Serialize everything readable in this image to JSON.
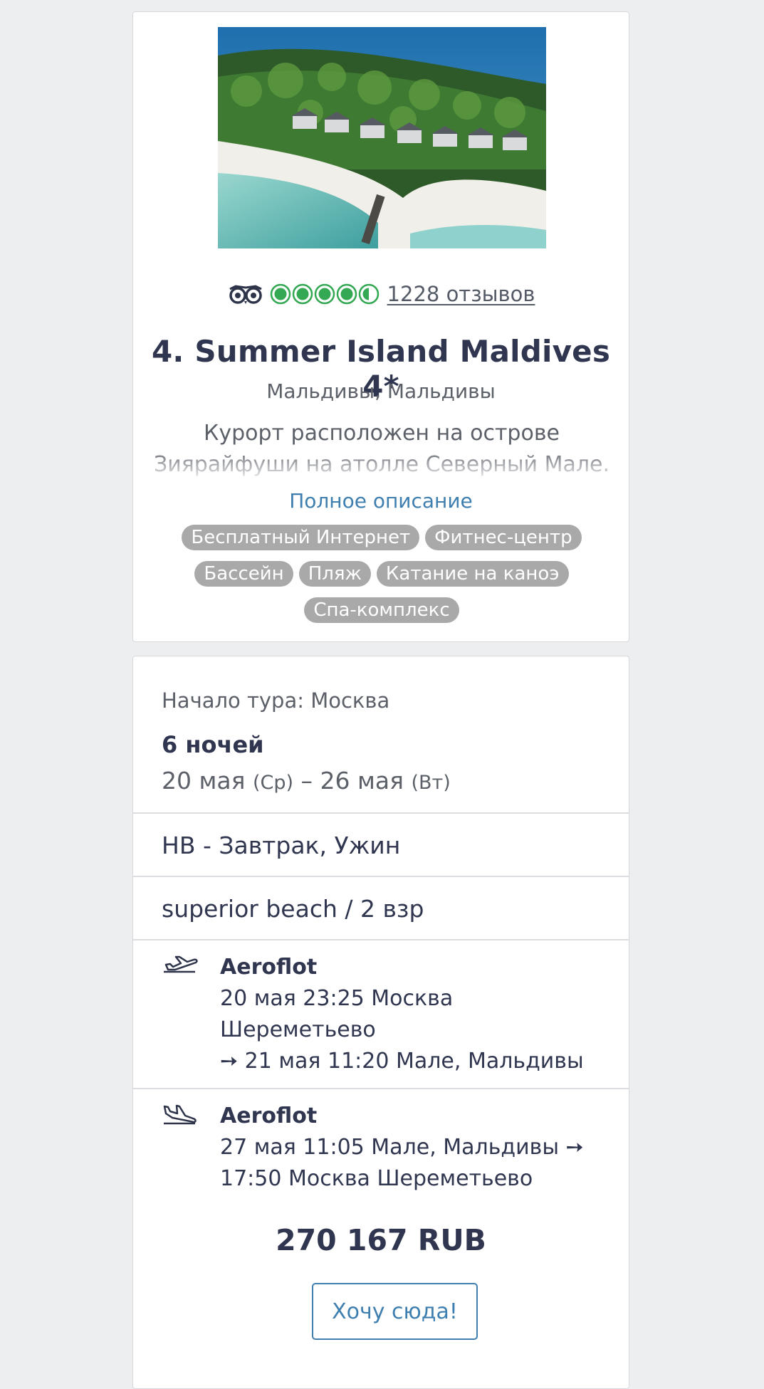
{
  "hotel": {
    "rating": {
      "bubbles_filled": 4.5,
      "bubbles_total": 5,
      "reviews_label": "1228 отзывов"
    },
    "title": "4. Summer Island Maldives 4*",
    "location": "Мальдивы, Мальдивы",
    "description": "Курорт расположен на острове Зиярайфуши на атолле Северный Мале. К",
    "full_description_link": "Полное описание",
    "amenities": [
      "Бесплатный Интернет",
      "Фитнес-центр",
      "Бассейн",
      "Пляж",
      "Катание на каноэ",
      "Спа-комплекс"
    ]
  },
  "tour": {
    "start_label": "Начало тура: Москва",
    "nights": "6 ночей",
    "date_from": "20 мая",
    "weekday_from": "(Ср)",
    "date_sep": " – ",
    "date_to": "26 мая",
    "weekday_to": "(Вт)",
    "meal": "HB - Завтрак, Ужин",
    "room": "superior beach / 2 взр",
    "flights": [
      {
        "direction": "outbound",
        "icon": "plane-takeoff-icon",
        "airline": "Aeroflot",
        "lines": [
          "20 мая 23:25 Москва",
          "Шереметьево",
          "➙ 21 мая 11:20 Мале, Мальдивы"
        ]
      },
      {
        "direction": "return",
        "icon": "plane-landing-icon",
        "airline": "Aeroflot",
        "lines": [
          "27 мая 11:05 Мале, Мальдивы ➙",
          "17:50 Москва Шереметьево"
        ]
      }
    ],
    "price": "270 167 RUB",
    "cta_label": "Хочу сюда!"
  },
  "colors": {
    "background": "#edeef0",
    "text_dark": "#303650",
    "text_muted": "#5c6068",
    "link": "#3f7fb0",
    "tag_bg": "#a9a9a9",
    "tripadvisor_green": "#34a853"
  }
}
